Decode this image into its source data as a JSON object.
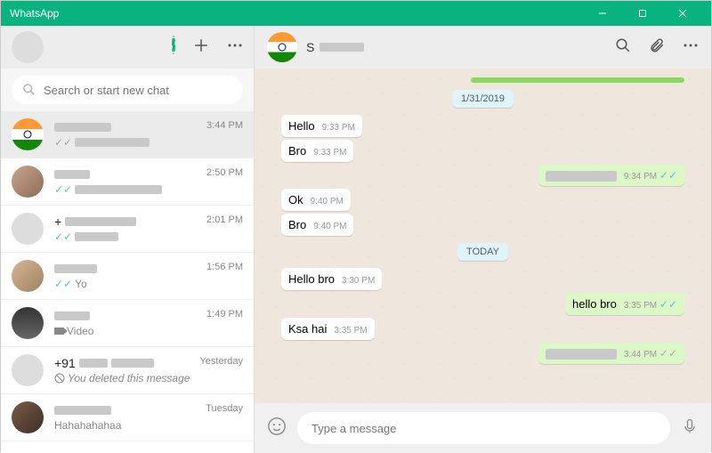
{
  "app": {
    "title": "WhatsApp"
  },
  "search": {
    "placeholder": "Search or start new chat"
  },
  "chats": [
    {
      "name": "████████",
      "time": "3:44 PM",
      "preview": "████████████",
      "tick": "gray",
      "selected": true,
      "avatar": "flag"
    },
    {
      "name": "█████",
      "time": "2:50 PM",
      "preview": "██████████████",
      "tick": "blue",
      "avatar": "ph1"
    },
    {
      "name": "+ ██████████",
      "time": "2:01 PM",
      "preview": "███████",
      "tick": "blue",
      "avatar": "plain"
    },
    {
      "name": "██████",
      "time": "1:56 PM",
      "preview": "Yo",
      "tick": "blue",
      "avatar": "ph2"
    },
    {
      "name": "█████",
      "time": "1:49 PM",
      "preview": "Video",
      "video": true,
      "avatar": "ph3"
    },
    {
      "name": "+91 ████ ██████",
      "time": "Yesterday",
      "preview": "You deleted this message",
      "deleted": true,
      "avatar": "plain"
    },
    {
      "name": "████████",
      "time": "Tuesday",
      "preview": "Hahahahahaa",
      "avatar": "ph4"
    }
  ],
  "conversation": {
    "title": "S",
    "dates": {
      "d1": "1/31/2019",
      "d2": "TODAY"
    },
    "messages": [
      {
        "side": "in",
        "text": "Hello",
        "time": "9:33 PM"
      },
      {
        "side": "in",
        "text": "Bro",
        "time": "9:33 PM"
      },
      {
        "side": "out",
        "redacted": true,
        "time": "9:34 PM",
        "tick": "blue"
      },
      {
        "side": "in",
        "text": "Ok",
        "time": "9:40 PM"
      },
      {
        "side": "in",
        "text": "Bro",
        "time": "9:40 PM"
      },
      {
        "side": "in",
        "text": "Hello bro",
        "time": "3:30 PM"
      },
      {
        "side": "out",
        "text": "hello bro",
        "time": "3:35 PM",
        "tick": "blue"
      },
      {
        "side": "in",
        "text": "Ksa hai",
        "time": "3:35 PM"
      },
      {
        "side": "out",
        "redacted": true,
        "time": "3:44 PM",
        "tick": "gray"
      }
    ]
  },
  "composer": {
    "placeholder": "Type a message"
  }
}
